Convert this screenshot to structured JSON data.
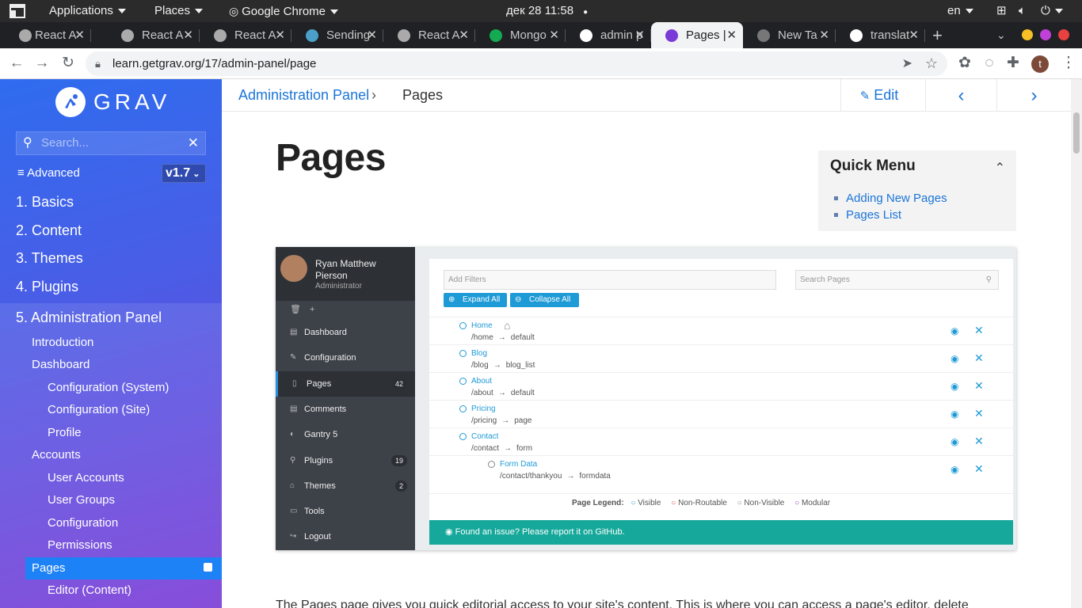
{
  "os_bar": {
    "applications": "Applications",
    "places": "Places",
    "chrome": "Google Chrome",
    "datetime": "дек 28  11:58",
    "lang": "en"
  },
  "tabs": [
    {
      "title": "React A",
      "icon": "globe-icon",
      "active": false
    },
    {
      "title": "React A",
      "icon": "globe-icon",
      "active": false
    },
    {
      "title": "React A",
      "icon": "globe-icon",
      "active": false
    },
    {
      "title": "Sending",
      "icon": "message-icon",
      "active": false
    },
    {
      "title": "React A",
      "icon": "globe-icon",
      "active": false
    },
    {
      "title": "Mongo",
      "icon": "mongodb-leaf-icon",
      "active": false
    },
    {
      "title": "admin p",
      "icon": "google-icon",
      "active": false
    },
    {
      "title": "Pages |",
      "icon": "grav-icon",
      "active": true
    },
    {
      "title": "New Ta",
      "icon": "chrome-icon",
      "active": false
    },
    {
      "title": "translat",
      "icon": "google-icon",
      "active": false
    }
  ],
  "address": {
    "url": "learn.getgrav.org/17/admin-panel/page"
  },
  "profile_initial": "t",
  "sidebar": {
    "logo": "GRAV",
    "search_placeholder": "Search...",
    "advanced": "Advanced",
    "version": "v1.7",
    "items": [
      {
        "label": "1. Basics",
        "level": 1
      },
      {
        "label": "2. Content",
        "level": 1
      },
      {
        "label": "3. Themes",
        "level": 1
      },
      {
        "label": "4. Plugins",
        "level": 1
      },
      {
        "label": "5. Administration Panel",
        "level": 1
      },
      {
        "label": "Introduction",
        "level": 2
      },
      {
        "label": "Dashboard",
        "level": 2
      },
      {
        "label": "Configuration (System)",
        "level": 3
      },
      {
        "label": "Configuration (Site)",
        "level": 3
      },
      {
        "label": "Profile",
        "level": 3
      },
      {
        "label": "Accounts",
        "level": 2
      },
      {
        "label": "User Accounts",
        "level": 3
      },
      {
        "label": "User Groups",
        "level": 3
      },
      {
        "label": "Configuration",
        "level": 3
      },
      {
        "label": "Permissions",
        "level": 3
      },
      {
        "label": "Pages",
        "level": 2
      },
      {
        "label": "Editor (Content)",
        "level": 3
      }
    ]
  },
  "breadcrumb": {
    "parent": "Administration Panel",
    "separator": "›",
    "current": "Pages"
  },
  "header_actions": {
    "edit": "Edit"
  },
  "page_title": "Pages",
  "quick_menu": {
    "title": "Quick Menu",
    "links": [
      "Adding New Pages",
      "Pages List"
    ]
  },
  "admin_screenshot": {
    "user_name": "Ryan Matthew Pierson",
    "user_role": "Administrator",
    "menu": [
      {
        "label": "Dashboard",
        "count": ""
      },
      {
        "label": "Configuration",
        "count": ""
      },
      {
        "label": "Pages",
        "count": "42"
      },
      {
        "label": "Comments",
        "count": ""
      },
      {
        "label": "Gantry 5",
        "count": ""
      },
      {
        "label": "Plugins",
        "count": "19"
      },
      {
        "label": "Themes",
        "count": "2"
      },
      {
        "label": "Tools",
        "count": ""
      },
      {
        "label": "Logout",
        "count": ""
      }
    ],
    "filter_placeholder": "Add Filters",
    "search_placeholder": "Search Pages",
    "expand_all": "Expand All",
    "collapse_all": "Collapse All",
    "pages": [
      {
        "title": "Home",
        "route": "/home",
        "arrow": "→",
        "template": "default"
      },
      {
        "title": "Blog",
        "route": "/blog",
        "arrow": "→",
        "template": "blog_list"
      },
      {
        "title": "About",
        "route": "/about",
        "arrow": "→",
        "template": "default"
      },
      {
        "title": "Pricing",
        "route": "/pricing",
        "arrow": "→",
        "template": "page"
      },
      {
        "title": "Contact",
        "route": "/contact",
        "arrow": "→",
        "template": "form"
      },
      {
        "title": "Form Data",
        "route": "/contact/thankyou",
        "arrow": "→",
        "template": "formdata"
      }
    ],
    "legend": {
      "label": "Page Legend:",
      "visible": "Visible",
      "non_routable": "Non-Routable",
      "non_visible": "Non-Visible",
      "modular": "Modular"
    },
    "issue": "Found an issue? Please report it on GitHub."
  },
  "body_text": "The Pages page gives you quick editorial access to your site's content. This is where you can access a page's editor, delete",
  "colors": {
    "accent": "#1b75d8",
    "admin_blue": "#1e9ad6",
    "teal": "#16a89a"
  }
}
